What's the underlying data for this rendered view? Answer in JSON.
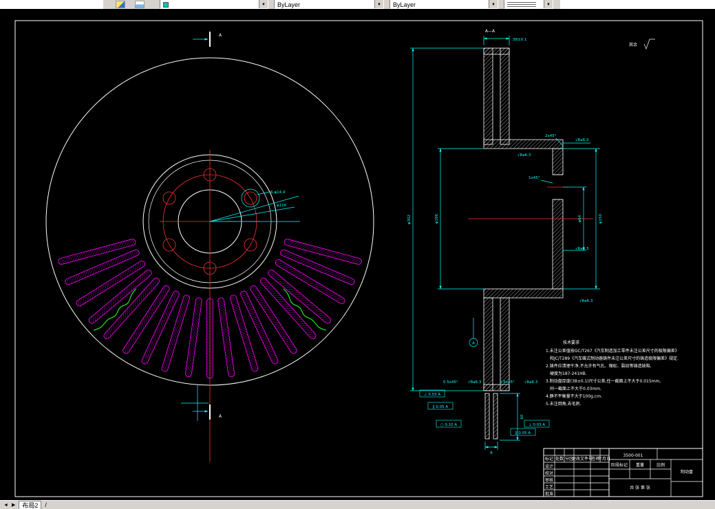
{
  "toolbar": {
    "color_value": "ByLayer",
    "linetype_value": "ByLayer",
    "dropdown_glyph": "▼"
  },
  "statusbar": {
    "nav_prev": "◄",
    "nav_next": "▶",
    "tab_label": "布局2",
    "separator": "/"
  },
  "drawing": {
    "section_title": "A—A",
    "surface_rest_label": "其余",
    "cut_label": "A",
    "dims": {
      "bolt_note": "6-φ14.4",
      "hub_dia": "φ116",
      "outer_dia": "φ302",
      "hat_dia": "φ186",
      "bore_dia": "φ64",
      "flange_dia": "φ150",
      "thickness": "38±0.1",
      "slot_width": "8",
      "bar_height": "60",
      "ra": "√Ra6.3",
      "chamfer_2x45": "2x45°",
      "chamfer_1x45": "1x45°",
      "chamfer_05x45": "0.5x45°",
      "datum": "A",
      "gdt1": "⊥ 0.03 A",
      "gdt2": "∥ 0.05 A",
      "gdt3": "○ 0.10 A",
      "gdt4": "∥ 0.05 A",
      "gdt5": "⊥ 0.03 A"
    },
    "tech_req": {
      "title": "技术要求",
      "lines": [
        "1.未注公差值按GC/T267《汽车制造加工零件未注公差尺寸的极限偏差》",
        "和JC/T289《汽车碟式制动器铸件未注公差尺寸的铸造极限偏差》规定.",
        "2.铸件应清理干净,不允许有气孔、缩松、裂纹等铸造缺陷,",
        "硬度为187-241HB.",
        "3.制动盘厚度(38±0.1)尺寸公差,任一截面上不大于0.015mm,",
        "同一截面上不大于0.03mm.",
        "4.静不平衡量不大于100g.cm.",
        "5.未注倒角,去毛刺."
      ]
    },
    "title_block": {
      "part_no": "3500-001",
      "part_name": "制动盘",
      "stage_label": "阶段标记",
      "weight_label": "重量",
      "scale_label": "比例",
      "sheet_label": "共 张 第 张",
      "header_row": [
        "标记",
        "处数",
        "分区",
        "更改文件号",
        "签名",
        "年月日"
      ],
      "sig_rows": [
        "设计",
        "校对",
        "审核",
        "工艺",
        "批准"
      ]
    }
  }
}
